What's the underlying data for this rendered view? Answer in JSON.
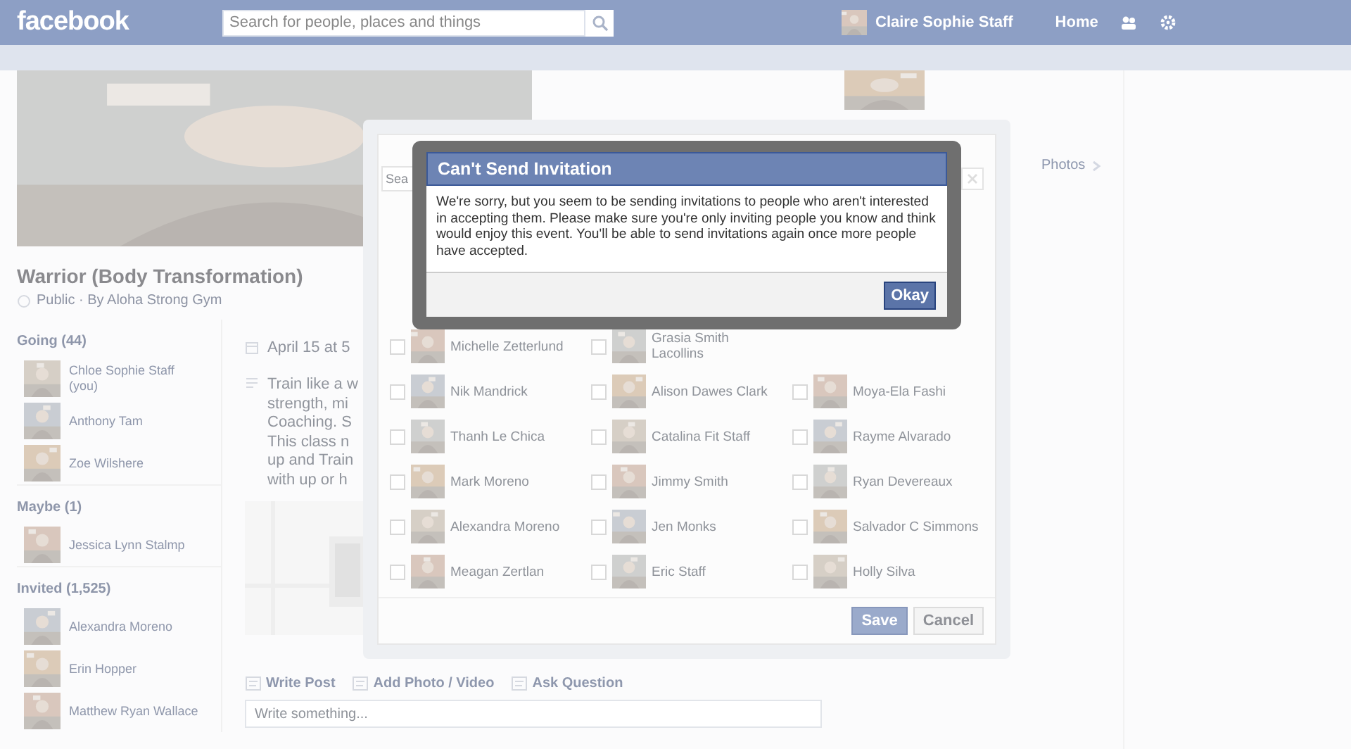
{
  "topbar": {
    "logo": "facebook",
    "search": {
      "placeholder": "Search for people, places and things"
    },
    "user": "Claire Sophie Staff",
    "home": "Home"
  },
  "event": {
    "title": "Warrior (Body Transformation)",
    "subtitle": "Public · By Aloha Strong Gym",
    "date": "April 15 at 5",
    "description": [
      "Train like a w",
      "strength, mi",
      "Coaching. S",
      "This class n",
      "up and Train",
      "with up or h"
    ]
  },
  "sidebar": [
    {
      "title": "Going (44)",
      "people": [
        "Chloe Sophie Staff (you)",
        "Anthony Tam",
        "Zoe Wilshere"
      ]
    },
    {
      "title": "Maybe (1)",
      "people": [
        "Jessica Lynn Stalmp"
      ]
    },
    {
      "title": "Invited (1,525)",
      "people": [
        "Alexandra Moreno",
        "Erin Hopper",
        "Matthew Ryan Wallace"
      ]
    }
  ],
  "right": {
    "link": "Photos"
  },
  "invite": {
    "search_placeholder": "Sea",
    "rows": [
      [
        {
          "name": "Michelle Zetterlund",
          "checked": false
        },
        {
          "name": "Grasia Smith Lacollins",
          "checked": false
        }
      ],
      [
        {
          "name": "Nik Mandrick",
          "checked": false
        },
        {
          "name": "Alison Dawes Clark",
          "checked": false
        },
        {
          "name": "Moya-Ela Fashi",
          "checked": false
        }
      ],
      [
        {
          "name": "Thanh Le Chica",
          "checked": false
        },
        {
          "name": "Catalina Fit Staff",
          "checked": false
        },
        {
          "name": "Rayme Alvarado",
          "checked": false
        }
      ],
      [
        {
          "name": "Mark Moreno",
          "checked": false
        },
        {
          "name": "Jimmy Smith",
          "checked": false
        },
        {
          "name": "Ryan Devereaux",
          "checked": false
        }
      ],
      [
        {
          "name": "Alexandra Moreno",
          "checked": false
        },
        {
          "name": "Jen Monks",
          "checked": false
        },
        {
          "name": "Salvador C Simmons",
          "checked": false
        }
      ],
      [
        {
          "name": "Meagan Zertlan",
          "checked": false
        },
        {
          "name": "Eric Staff",
          "checked": false
        },
        {
          "name": "Holly Silva",
          "checked": false
        }
      ]
    ],
    "buttons": [
      {
        "label": "Save",
        "primary": true
      },
      {
        "label": "Cancel",
        "primary": false
      }
    ]
  },
  "alert": {
    "title": "Can't Send Invitation",
    "message": "We're sorry, but you seem to be sending invitations to people who aren't interested in accepting them. Please make sure you're only inviting people you know and think would enjoy this event. You'll be able to send invitations again once more people have accepted.",
    "button": "Okay"
  },
  "composer": {
    "actions": [
      "Write Post",
      "Add Photo / Video",
      "Ask Question"
    ],
    "placeholder": "Write something..."
  }
}
